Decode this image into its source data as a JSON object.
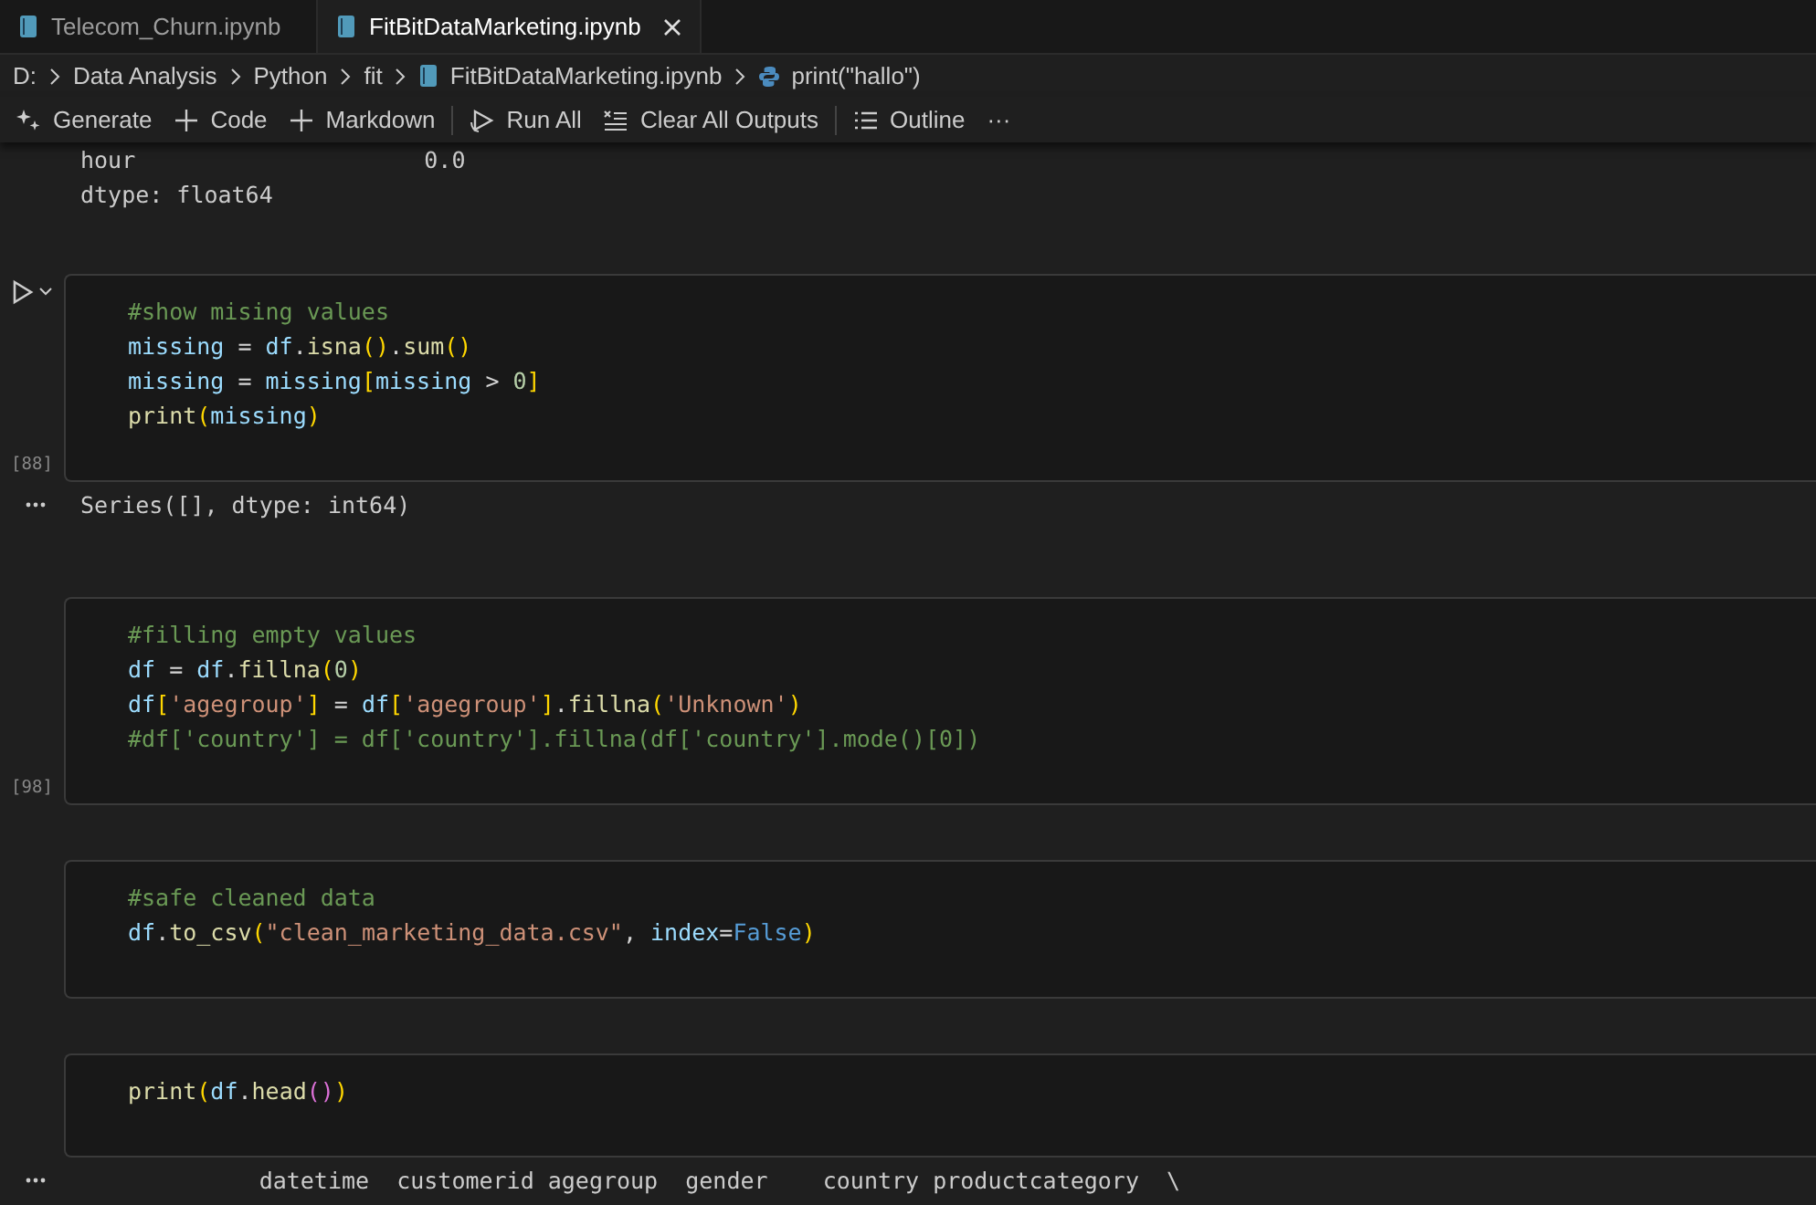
{
  "tabs": [
    {
      "label": "Telecom_Churn.ipynb",
      "selected": false,
      "closable": false
    },
    {
      "label": "FitBitDataMarketing.ipynb",
      "selected": true,
      "closable": true
    }
  ],
  "breadcrumb": [
    {
      "label": "D:",
      "kind": "folder"
    },
    {
      "label": "Data Analysis",
      "kind": "folder"
    },
    {
      "label": "Python",
      "kind": "folder"
    },
    {
      "label": "fit",
      "kind": "folder"
    },
    {
      "label": "FitBitDataMarketing.ipynb",
      "kind": "notebook"
    },
    {
      "label": "print(\"hallo\")",
      "kind": "python"
    }
  ],
  "toolbar": [
    {
      "label": "Generate",
      "kind": "sparkle"
    },
    {
      "label": "Code",
      "kind": "plus"
    },
    {
      "label": "Markdown",
      "kind": "plus"
    },
    {
      "label": "Run All",
      "kind": "run",
      "divider_before": true
    },
    {
      "label": "Clear All Outputs",
      "kind": "clear"
    },
    {
      "label": "Outline",
      "kind": "outline",
      "divider_before": true
    },
    {
      "label": "···",
      "kind": "more"
    }
  ],
  "top_output": [
    "hour                     0.0",
    "dtype: float64"
  ],
  "cells": [
    {
      "run_button": true,
      "exec_count": "[88]",
      "lines": [
        [
          {
            "t": "#show mising values",
            "kind": "comment"
          }
        ],
        [
          {
            "t": "missing",
            "kind": "variable"
          },
          {
            "t": " = ",
            "kind": "operator"
          },
          {
            "t": "df",
            "kind": "variable"
          },
          {
            "t": ".",
            "kind": "operator"
          },
          {
            "t": "isna",
            "kind": "function"
          },
          {
            "t": "()",
            "kind": "bracket"
          },
          {
            "t": ".",
            "kind": "operator"
          },
          {
            "t": "sum",
            "kind": "function"
          },
          {
            "t": "()",
            "kind": "bracket"
          }
        ],
        [
          {
            "t": "missing",
            "kind": "variable"
          },
          {
            "t": " = ",
            "kind": "operator"
          },
          {
            "t": "missing",
            "kind": "variable"
          },
          {
            "t": "[",
            "kind": "bracket"
          },
          {
            "t": "missing",
            "kind": "variable"
          },
          {
            "t": " > ",
            "kind": "operator"
          },
          {
            "t": "0",
            "kind": "number"
          },
          {
            "t": "]",
            "kind": "bracket"
          }
        ],
        [
          {
            "t": "print",
            "kind": "function"
          },
          {
            "t": "(",
            "kind": "bracket"
          },
          {
            "t": "missing",
            "kind": "variable"
          },
          {
            "t": ")",
            "kind": "bracket"
          }
        ]
      ],
      "output": [
        "Series([], dtype: int64)"
      ]
    },
    {
      "run_button": false,
      "exec_count": "[98]",
      "lines": [
        [
          {
            "t": "#filling empty values",
            "kind": "comment"
          }
        ],
        [
          {
            "t": "df",
            "kind": "variable"
          },
          {
            "t": " = ",
            "kind": "operator"
          },
          {
            "t": "df",
            "kind": "variable"
          },
          {
            "t": ".",
            "kind": "operator"
          },
          {
            "t": "fillna",
            "kind": "function"
          },
          {
            "t": "(",
            "kind": "bracket"
          },
          {
            "t": "0",
            "kind": "number"
          },
          {
            "t": ")",
            "kind": "bracket"
          }
        ],
        [
          {
            "t": "df",
            "kind": "variable"
          },
          {
            "t": "[",
            "kind": "bracket"
          },
          {
            "t": "'agegroup'",
            "kind": "string"
          },
          {
            "t": "]",
            "kind": "bracket"
          },
          {
            "t": " = ",
            "kind": "operator"
          },
          {
            "t": "df",
            "kind": "variable"
          },
          {
            "t": "[",
            "kind": "bracket"
          },
          {
            "t": "'agegroup'",
            "kind": "string"
          },
          {
            "t": "]",
            "kind": "bracket"
          },
          {
            "t": ".",
            "kind": "operator"
          },
          {
            "t": "fillna",
            "kind": "function"
          },
          {
            "t": "(",
            "kind": "bracket"
          },
          {
            "t": "'Unknown'",
            "kind": "string"
          },
          {
            "t": ")",
            "kind": "bracket"
          }
        ],
        [
          {
            "t": "#df['country'] = df['country'].fillna(df['country'].mode()[0])",
            "kind": "comment"
          }
        ]
      ]
    },
    {
      "run_button": false,
      "lines": [
        [
          {
            "t": "#safe cleaned data",
            "kind": "comment"
          }
        ],
        [
          {
            "t": "df",
            "kind": "variable"
          },
          {
            "t": ".",
            "kind": "operator"
          },
          {
            "t": "to_csv",
            "kind": "function"
          },
          {
            "t": "(",
            "kind": "bracket"
          },
          {
            "t": "\"clean_marketing_data.csv\"",
            "kind": "string"
          },
          {
            "t": ", ",
            "kind": "operator"
          },
          {
            "t": "index",
            "kind": "variable"
          },
          {
            "t": "=",
            "kind": "operator"
          },
          {
            "t": "False",
            "kind": "keyword"
          },
          {
            "t": ")",
            "kind": "bracket"
          }
        ]
      ]
    },
    {
      "run_button": false,
      "lines": [
        [
          {
            "t": "print",
            "kind": "function"
          },
          {
            "t": "(",
            "kind": "bracket"
          },
          {
            "t": "df",
            "kind": "variable"
          },
          {
            "t": ".",
            "kind": "operator"
          },
          {
            "t": "head",
            "kind": "function"
          },
          {
            "t": "(",
            "kind": "bracket2"
          },
          {
            "t": ")",
            "kind": "bracket2"
          },
          {
            "t": ")",
            "kind": "bracket"
          }
        ]
      ],
      "output": [
        "             datetime  customerid agegroup  gender    country productcategory  \\"
      ]
    }
  ]
}
